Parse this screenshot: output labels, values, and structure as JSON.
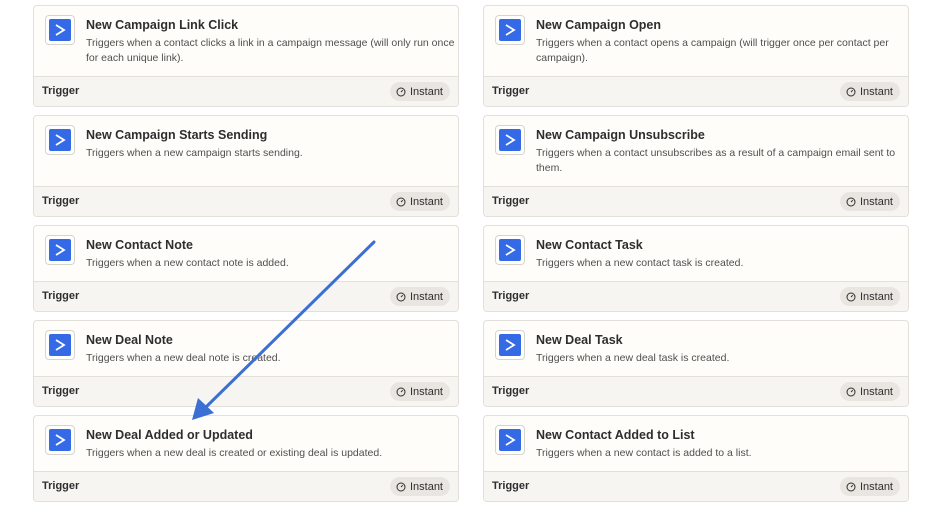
{
  "footer_label": "Trigger",
  "badge_label": "Instant",
  "brand_color": "#356ae6",
  "icons": {
    "app": "activecampaign-chevron-icon",
    "badge": "clock-icon"
  },
  "cards": [
    {
      "title": "New Campaign Link Click",
      "description": "Triggers when a contact clicks a link in a campaign message (will only run once for each unique link)."
    },
    {
      "title": "New Campaign Open",
      "description": "Triggers when a contact opens a campaign (will trigger once per contact per campaign)."
    },
    {
      "title": "New Campaign Starts Sending",
      "description": "Triggers when a new campaign starts sending."
    },
    {
      "title": "New Campaign Unsubscribe",
      "description": "Triggers when a contact unsubscribes as a result of a campaign email sent to them."
    },
    {
      "title": "New Contact Note",
      "description": "Triggers when a new contact note is added."
    },
    {
      "title": "New Contact Task",
      "description": "Triggers when a new contact task is created."
    },
    {
      "title": "New Deal Note",
      "description": "Triggers when a new deal note is created."
    },
    {
      "title": "New Deal Task",
      "description": "Triggers when a new deal task is created."
    },
    {
      "title": "New Deal Added or Updated",
      "description": "Triggers when a new deal is created or existing deal is updated."
    },
    {
      "title": "New Contact Added to List",
      "description": "Triggers when a new contact is added to a list."
    }
  ]
}
